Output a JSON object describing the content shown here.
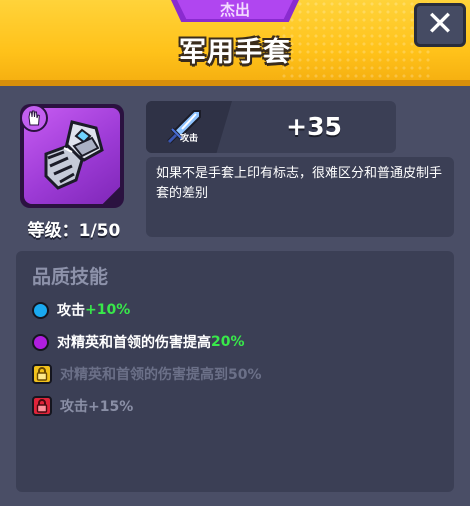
{
  "header": {
    "rarity": "杰出",
    "title": "军用手套",
    "close_glyph": "✕"
  },
  "item": {
    "icon": "gauntlet-icon",
    "type_badge_icon": "hand-icon",
    "level_label": "等级：",
    "level_value": "1/50",
    "level": 1,
    "level_max": 50
  },
  "stat": {
    "icon": "sword-icon",
    "label": "攻击",
    "value": "+35"
  },
  "description": "如果不是手套上印有标志，很难区分和普通皮制手套的差别",
  "skills": {
    "title": "品质技能",
    "items": [
      {
        "indicator": "blue-dot",
        "text": "攻击",
        "highlight": "+10%",
        "state": "unlocked"
      },
      {
        "indicator": "purple-dot",
        "text": "对精英和首领的伤害提高",
        "highlight": "20%",
        "state": "unlocked"
      },
      {
        "indicator": "yellow-lock",
        "text": "对精英和首领的伤害提高到50%",
        "highlight": "",
        "state": "locked"
      },
      {
        "indicator": "red-lock",
        "text": "攻击+15%",
        "highlight": "",
        "state": "locked"
      }
    ]
  },
  "colors": {
    "header_yellow": "#ffc21a",
    "rarity_purple": "#b046f0",
    "panel": "#4a4e66",
    "highlight_green": "#38e84a",
    "blue_dot": "#1aa9f0",
    "purple_dot": "#b01ee0",
    "yellow_lock": "#f2c21c",
    "red_lock": "#e0243a"
  }
}
